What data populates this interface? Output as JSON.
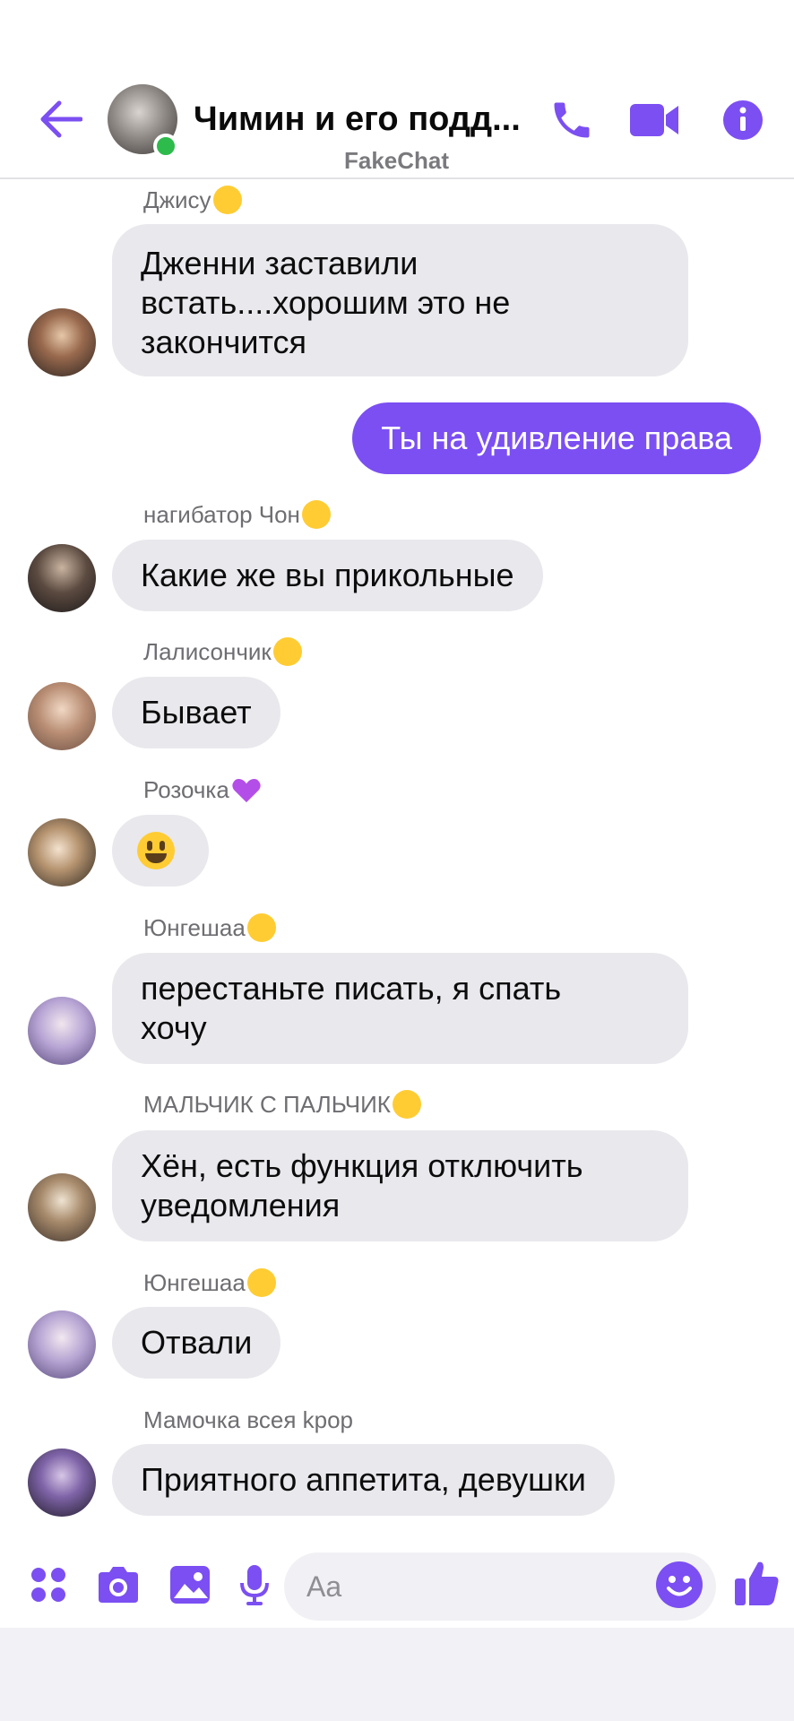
{
  "header": {
    "title": "Чимин и его подд...",
    "subtitle": "FakeChat",
    "accent": "#7b4ff2"
  },
  "messages": [
    {
      "sender": "Джису",
      "sender_emoji": "winking-tongue",
      "text_lines": [
        "Дженни заставили",
        "встать....хорошим это не",
        "закончится"
      ]
    },
    {
      "outgoing": true,
      "text": "Ты на удивление права"
    },
    {
      "sender": "нагибатор Чон",
      "sender_emoji": "wink",
      "text": "Какие же вы прикольные"
    },
    {
      "sender": "Лалисончик",
      "sender_emoji": "kissing-smiling",
      "text": "Бывает"
    },
    {
      "sender": "Розочка",
      "sender_emoji": "purple-heart",
      "text": "😃"
    },
    {
      "sender": "Юнгешаа",
      "sender_emoji": "zany",
      "text_lines": [
        "перестаньте писать, я спать",
        "хочу"
      ]
    },
    {
      "sender": "МАЛЬЧИК С ПАЛЬЧИК",
      "sender_emoji": "grinning",
      "text_lines": [
        "Хён, есть функция отключить",
        "уведомления"
      ]
    },
    {
      "sender": "Юнгешаа",
      "sender_emoji": "zany",
      "text": "Отвали"
    },
    {
      "sender": "Мамочка всея kpop",
      "text": "Приятного аппетита, девушки"
    }
  ],
  "composer": {
    "placeholder": "Aa"
  },
  "icons": [
    "back-arrow",
    "phone",
    "video-camera",
    "info",
    "menu-dots",
    "camera",
    "image",
    "microphone",
    "emoji",
    "thumbs-up"
  ]
}
